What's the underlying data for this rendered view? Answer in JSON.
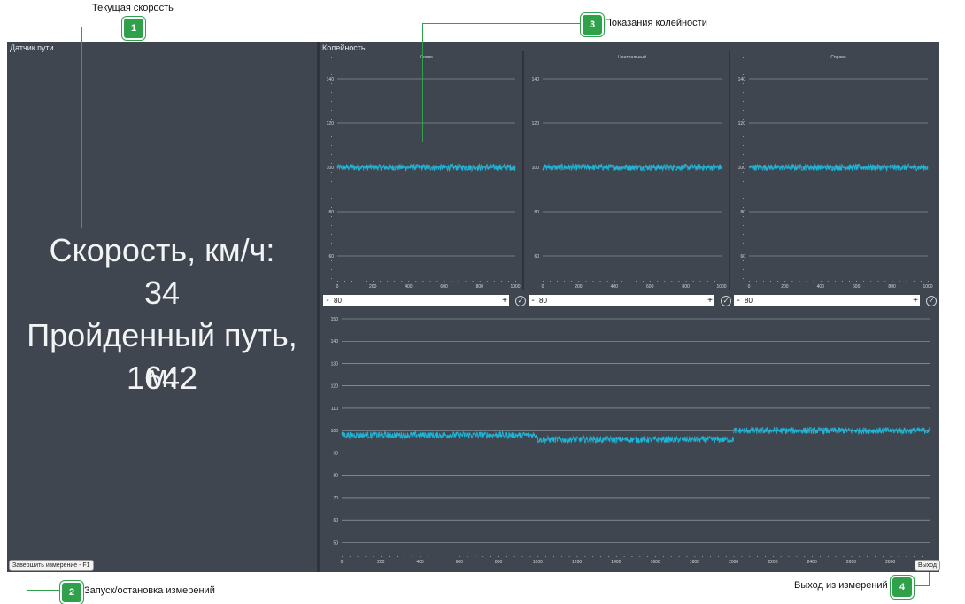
{
  "annotations": {
    "a1": {
      "num": "1",
      "label": "Текущая скорость"
    },
    "a2": {
      "num": "2",
      "label": "Запуск/остановка измерений"
    },
    "a3": {
      "num": "3",
      "label": "Показания колейности"
    },
    "a4": {
      "num": "4",
      "label": "Выход из измерений"
    }
  },
  "left_panel": {
    "title": "Датчик пути",
    "speed_label": "Скорость, км/ч:",
    "speed_value": "34",
    "distance_label": "Пройденный путь, м:",
    "distance_value": "1642",
    "finish_button": "Завершить измерение - F1"
  },
  "right_panel": {
    "title": "Колейность",
    "exit_button": "Выход"
  },
  "controls": [
    {
      "minus": "-",
      "value": "80",
      "plus": "+",
      "check": "✓"
    },
    {
      "minus": "-",
      "value": "80",
      "plus": "+",
      "check": "✓"
    },
    {
      "minus": "-",
      "value": "80",
      "plus": "+",
      "check": "✓"
    }
  ],
  "chart_data": [
    {
      "type": "line",
      "title": "Слева",
      "xlim": [
        0,
        1000
      ],
      "ylim": [
        50,
        150
      ],
      "xticks": [
        0,
        200,
        400,
        600,
        800,
        1000
      ],
      "yticks": [
        60,
        80,
        100,
        120,
        140
      ],
      "series": [
        {
          "x_range": [
            0,
            1000
          ],
          "mean": 100,
          "noise": 1.5
        }
      ],
      "grid": true,
      "line_color": "#1fb3d5"
    },
    {
      "type": "line",
      "title": "Центральный",
      "xlim": [
        0,
        1000
      ],
      "ylim": [
        50,
        150
      ],
      "xticks": [
        0,
        200,
        400,
        600,
        800,
        1000
      ],
      "yticks": [
        60,
        80,
        100,
        120,
        140
      ],
      "series": [
        {
          "x_range": [
            0,
            1000
          ],
          "mean": 100,
          "noise": 1.5
        }
      ],
      "grid": true,
      "line_color": "#1fb3d5"
    },
    {
      "type": "line",
      "title": "Справа",
      "xlim": [
        0,
        1000
      ],
      "ylim": [
        50,
        150
      ],
      "xticks": [
        0,
        200,
        400,
        600,
        800,
        1000
      ],
      "yticks": [
        60,
        80,
        100,
        120,
        140
      ],
      "series": [
        {
          "x_range": [
            0,
            1000
          ],
          "mean": 100,
          "noise": 1.5
        }
      ],
      "grid": true,
      "line_color": "#1fb3d5"
    },
    {
      "type": "line",
      "title": "",
      "xlim": [
        0,
        3000
      ],
      "ylim": [
        45,
        150
      ],
      "xticks": [
        0,
        200,
        400,
        600,
        800,
        1000,
        1200,
        1400,
        1600,
        1800,
        2000,
        2200,
        2400,
        2600,
        2800
      ],
      "yticks": [
        50,
        60,
        70,
        80,
        90,
        100,
        110,
        120,
        130,
        140,
        150
      ],
      "series": [
        {
          "x_range": [
            0,
            1000
          ],
          "mean": 98,
          "noise": 1.5
        },
        {
          "x_range": [
            1000,
            2000
          ],
          "mean": 96,
          "noise": 1.5
        },
        {
          "x_range": [
            2000,
            3000
          ],
          "mean": 100,
          "noise": 1.5
        }
      ],
      "grid": true,
      "line_color": "#1fb3d5"
    }
  ]
}
